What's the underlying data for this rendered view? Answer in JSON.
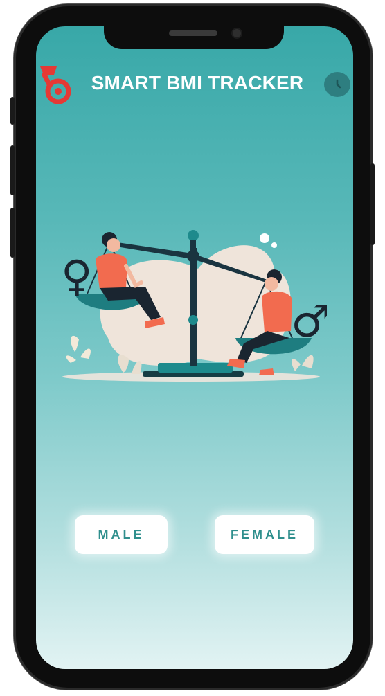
{
  "app": {
    "title": "SMART BMI TRACKER",
    "logo_icon": "bmi-logo-icon",
    "history_icon": "clock-icon"
  },
  "gender_options": {
    "male_label": "MALE",
    "female_label": "FEMALE"
  },
  "illustration": {
    "subject": "balance-scale-man-woman",
    "female_symbol": "♀",
    "male_symbol": "♂"
  },
  "colors": {
    "accent": "#2f8f8d",
    "logo_red": "#e53935",
    "gradient_top": "#38a8a8",
    "gradient_bottom": "#e2f3f3",
    "shirt": "#f26b4f",
    "button_bg": "#ffffff"
  }
}
